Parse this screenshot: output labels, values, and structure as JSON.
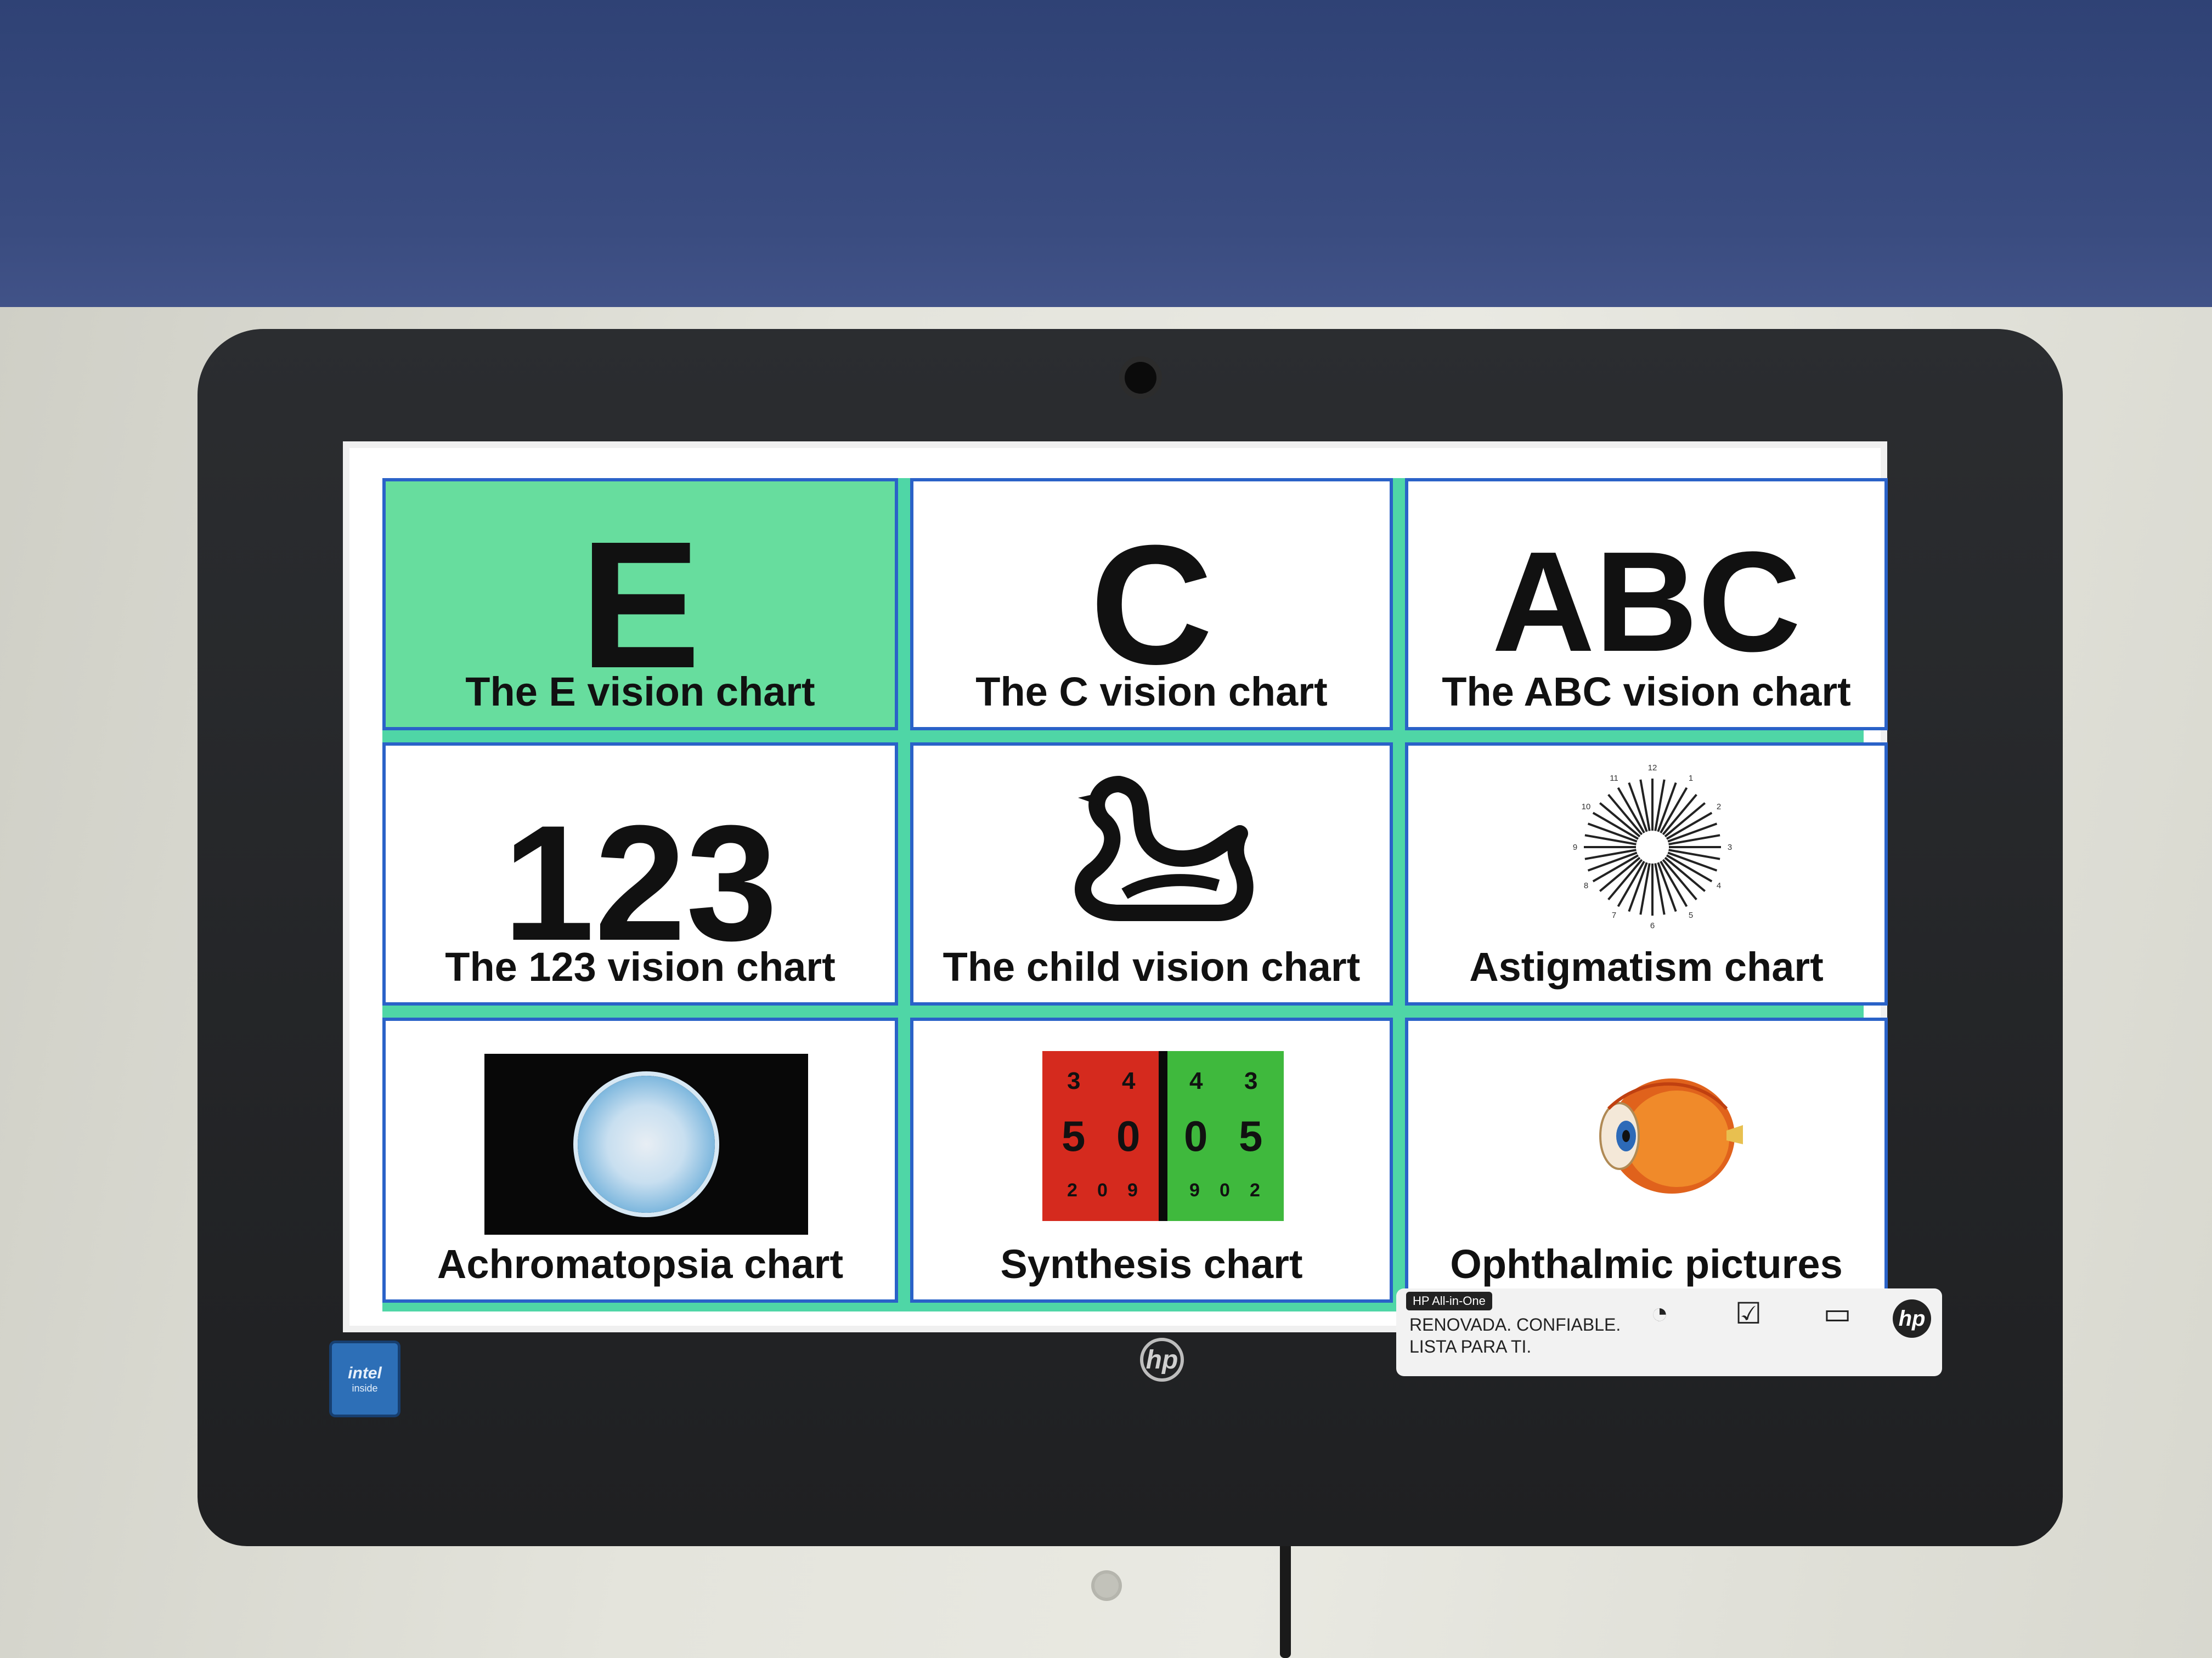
{
  "tiles": [
    {
      "glyph": "E",
      "label": "The E vision chart",
      "selected": true
    },
    {
      "glyph": "C",
      "label": "The C vision chart",
      "selected": false
    },
    {
      "glyph": "ABC",
      "label": "The ABC vision chart",
      "selected": false
    },
    {
      "glyph": "123",
      "label": "The 123 vision chart",
      "selected": false
    },
    {
      "glyph": "swan-icon",
      "label": "The child vision chart",
      "selected": false
    },
    {
      "glyph": "astigmatism-dial-icon",
      "label": "Astigmatism chart",
      "selected": false
    },
    {
      "glyph": "color-plate-icon",
      "label": "Achromatopsia chart",
      "selected": false
    },
    {
      "glyph": "red-green-numbers-icon",
      "label": "Synthesis chart",
      "selected": false
    },
    {
      "glyph": "eye-anatomy-icon",
      "label": "Ophthalmic pictures",
      "selected": false
    }
  ],
  "astig_numbers": [
    "12",
    "1",
    "2",
    "3",
    "4",
    "5",
    "6",
    "7",
    "8",
    "9",
    "10",
    "11"
  ],
  "synthesis": {
    "red_top": [
      "3",
      "4"
    ],
    "red_mid": [
      "5",
      "0"
    ],
    "red_bottom": [
      "2",
      "0",
      "9"
    ],
    "green_top": [
      "4",
      "3"
    ],
    "green_mid": [
      "0",
      "5"
    ],
    "green_bottom": [
      "9",
      "0",
      "2"
    ]
  },
  "device": {
    "brand_logo": "hp",
    "badge_top": "intel",
    "badge_bottom": "inside",
    "sticker_tag": "HP All-in-One",
    "sticker_line1": "RENOVADA. CONFIABLE.",
    "sticker_line2": "LISTA PARA TI."
  },
  "colors": {
    "selected_tile": "#67dd9e",
    "grid_lines": "#4fd6a6",
    "tile_border": "#2a62c8"
  }
}
